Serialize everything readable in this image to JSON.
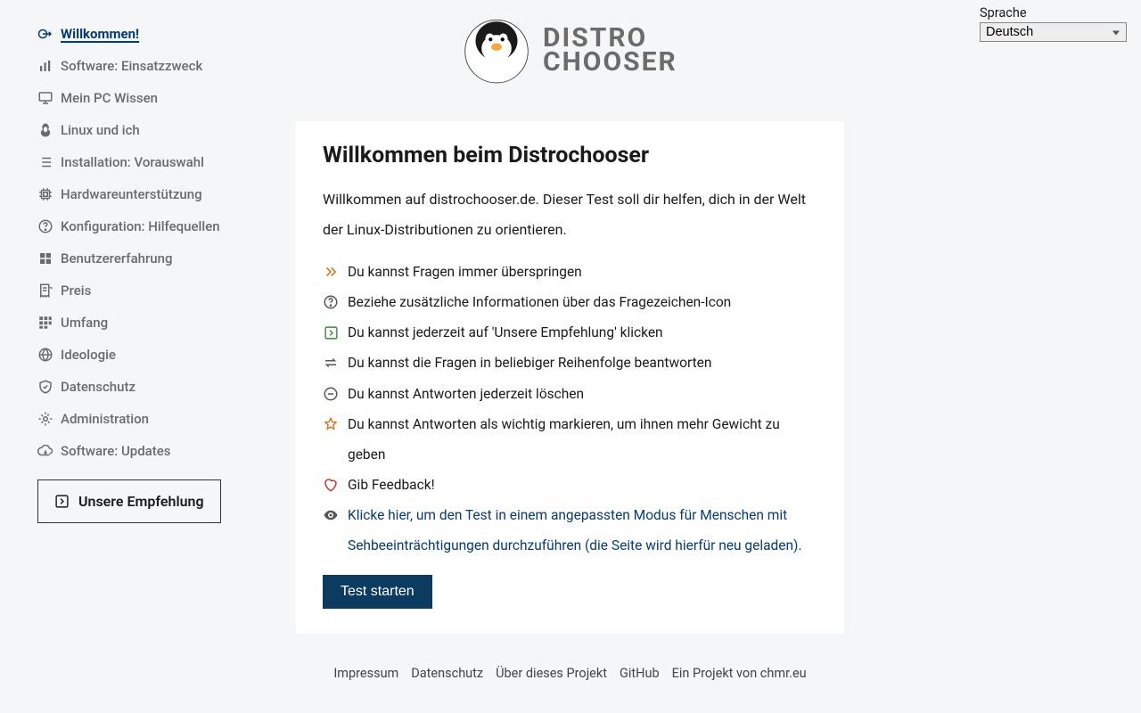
{
  "sidebar": {
    "items": [
      {
        "label": "Willkommen!",
        "icon": "login-icon",
        "active": true
      },
      {
        "label": "Software: Einsatzzweck",
        "icon": "bars-icon"
      },
      {
        "label": "Mein PC Wissen",
        "icon": "monitor-icon"
      },
      {
        "label": "Linux und ich",
        "icon": "penguin-icon"
      },
      {
        "label": "Installation: Vorauswahl",
        "icon": "list-icon"
      },
      {
        "label": "Hardwareunterstützung",
        "icon": "cpu-icon"
      },
      {
        "label": "Konfiguration: Hilfequellen",
        "icon": "question-icon"
      },
      {
        "label": "Benutzererfahrung",
        "icon": "grid-icon"
      },
      {
        "label": "Preis",
        "icon": "receipt-icon"
      },
      {
        "label": "Umfang",
        "icon": "tiles-icon"
      },
      {
        "label": "Ideologie",
        "icon": "globe-icon"
      },
      {
        "label": "Datenschutz",
        "icon": "shield-icon"
      },
      {
        "label": "Administration",
        "icon": "gear-icon"
      },
      {
        "label": "Software: Updates",
        "icon": "cloud-icon"
      }
    ],
    "recommendation": "Unsere Empfehlung"
  },
  "logo": {
    "line1": "DISTRO",
    "line2": "CHOOSER"
  },
  "language": {
    "label": "Sprache",
    "selected": "Deutsch"
  },
  "card": {
    "title": "Willkommen beim Distrochooser",
    "welcome": "Willkommen auf distrochooser.de. Dieser Test soll dir helfen, dich in der Welt der Linux-Distributionen zu orientieren.",
    "hints": [
      {
        "text": "Du kannst Fragen immer überspringen",
        "color": "#d07a2a"
      },
      {
        "text": "Beziehe zusätzliche Informationen über das Fragezeichen-Icon",
        "color": "#555"
      },
      {
        "text": "Du kannst jederzeit auf 'Unsere Empfehlung' klicken",
        "color": "#3a8a3a"
      },
      {
        "text": "Du kannst die Fragen in beliebiger Reihenfolge beantworten",
        "color": "#555"
      },
      {
        "text": "Du kannst Antworten jederzeit löschen",
        "color": "#555"
      },
      {
        "text": "Du kannst Antworten als wichtig markieren, um ihnen mehr Gewicht zu geben",
        "color": "#d07a2a"
      },
      {
        "text": "Gib Feedback!",
        "color": "#c33"
      },
      {
        "text": "Klicke hier, um den Test in einem angepassten Modus für Menschen mit Sehbeeinträchtigungen durchzuführen (die Seite wird hierfür neu geladen).",
        "color": "#555",
        "link": true
      }
    ],
    "start": "Test starten"
  },
  "footer": {
    "links": [
      "Impressum",
      "Datenschutz",
      "Über dieses Projekt",
      "GitHub",
      "Ein Projekt von chmr.eu"
    ]
  }
}
